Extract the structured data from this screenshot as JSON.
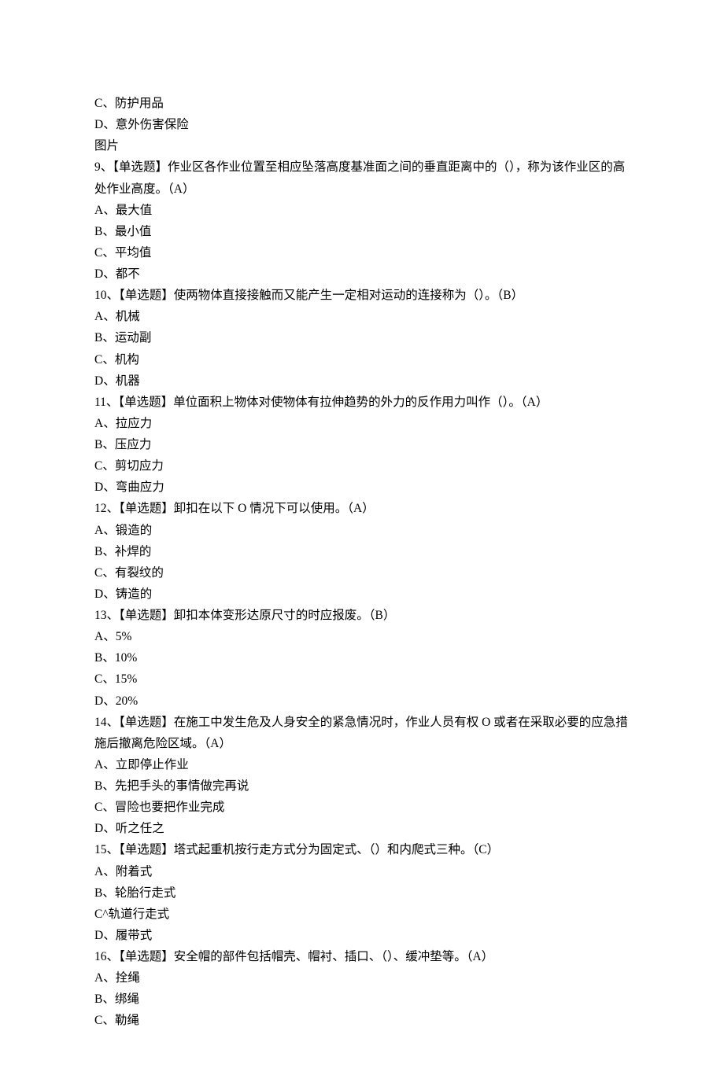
{
  "lines": [
    "C、防护用品",
    "D、意外伤害保险",
    "图片",
    "9、【单选题】作业区各作业位置至相应坠落高度基准面之间的垂直距离中的（），称为该作业区的高处作业高度。（A）",
    "A、最大值",
    "B、最小值",
    "C、平均值",
    "D、都不",
    "10、【单选题】使两物体直接接触而又能产生一定相对运动的连接称为（）。（B）",
    "A、机械",
    "B、运动副",
    "C、机构",
    "D、机器",
    "11、【单选题】单位面积上物体对使物体有拉伸趋势的外力的反作用力叫作（）。（A）",
    "A、拉应力",
    "B、压应力",
    "C、剪切应力",
    "D、弯曲应力",
    "12、【单选题】卸扣在以下 O 情况下可以使用。（A）",
    "A、锻造的",
    "B、补焊的",
    "C、有裂纹的",
    "D、铸造的",
    "13、【单选题】卸扣本体变形达原尺寸的时应报废。（B）",
    "A、5%",
    "B、10%",
    "C、15%",
    "D、20%",
    "14、【单选题】在施工中发生危及人身安全的紧急情况时，作业人员有权 O 或者在采取必要的应急措施后撤离危险区域。（A）",
    "A、立即停止作业",
    "B、先把手头的事情做完再说",
    "C、冒险也要把作业完成",
    "D、听之任之",
    "15、【单选题】塔式起重机按行走方式分为固定式、（）和内爬式三种。（C）",
    "A、附着式",
    "B、轮胎行走式",
    "C^轨道行走式",
    "D、履带式",
    "16、【单选题】安全帽的部件包括帽壳、帽衬、插口、（）、缓冲垫等。（A）",
    "A、拴绳",
    "B、绑绳",
    "C、勒绳"
  ]
}
